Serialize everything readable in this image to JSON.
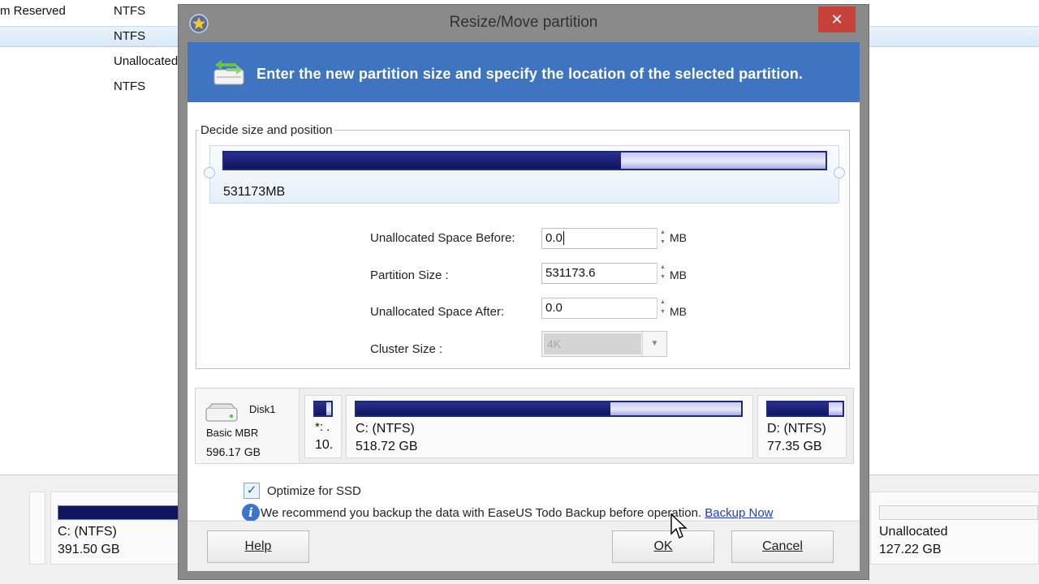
{
  "background": {
    "rows": [
      {
        "name": "m Reserved",
        "fs": "NTFS"
      },
      {
        "name": "",
        "fs": "NTFS"
      },
      {
        "name": "",
        "fs": "Unallocated"
      },
      {
        "name": "",
        "fs": "NTFS"
      }
    ],
    "disk_map": {
      "c_label": "C: (NTFS)",
      "c_size": "391.50 GB",
      "unalloc_label": "Unallocated",
      "unalloc_size": "127.22 GB"
    }
  },
  "dialog": {
    "title": "Resize/Move partition",
    "close_glyph": "✕",
    "banner_text": "Enter the new partition size and specify the location of the selected partition.",
    "group_title": "Decide size and position",
    "slider": {
      "size_label": "531173MB",
      "used_fraction": 0.66
    },
    "fields": {
      "unalloc_before_label": "Unallocated Space Before:",
      "unalloc_before_value": "0.0",
      "partition_size_label": "Partition Size :",
      "partition_size_value": "531173.6",
      "unalloc_after_label": "Unallocated Space After:",
      "unalloc_after_value": "0.0",
      "unit": "MB",
      "cluster_size_label": "Cluster Size :",
      "cluster_size_value": "4K"
    },
    "disk": {
      "name": "Disk1",
      "type": "Basic MBR",
      "size": "596.17 GB",
      "partitions": [
        {
          "label": "*: .",
          "size": "10.",
          "used_fraction": 0.7
        },
        {
          "label": "C: (NTFS)",
          "size": "518.72 GB",
          "used_fraction": 0.66
        },
        {
          "label": "D: (NTFS)",
          "size": "77.35 GB",
          "used_fraction": 0.82
        }
      ]
    },
    "optimize_ssd": {
      "label": "Optimize for SSD",
      "checked": true
    },
    "backup_notice": {
      "text": "We recommend you backup the data with EaseUS Todo Backup before operation.",
      "link": "Backup Now"
    },
    "buttons": {
      "help": "Help",
      "ok": "OK",
      "cancel": "Cancel"
    }
  },
  "colors": {
    "banner": "#3f74c1",
    "bar_used": "#10155e",
    "close": "#c7413b",
    "link": "#1b3fbf"
  }
}
